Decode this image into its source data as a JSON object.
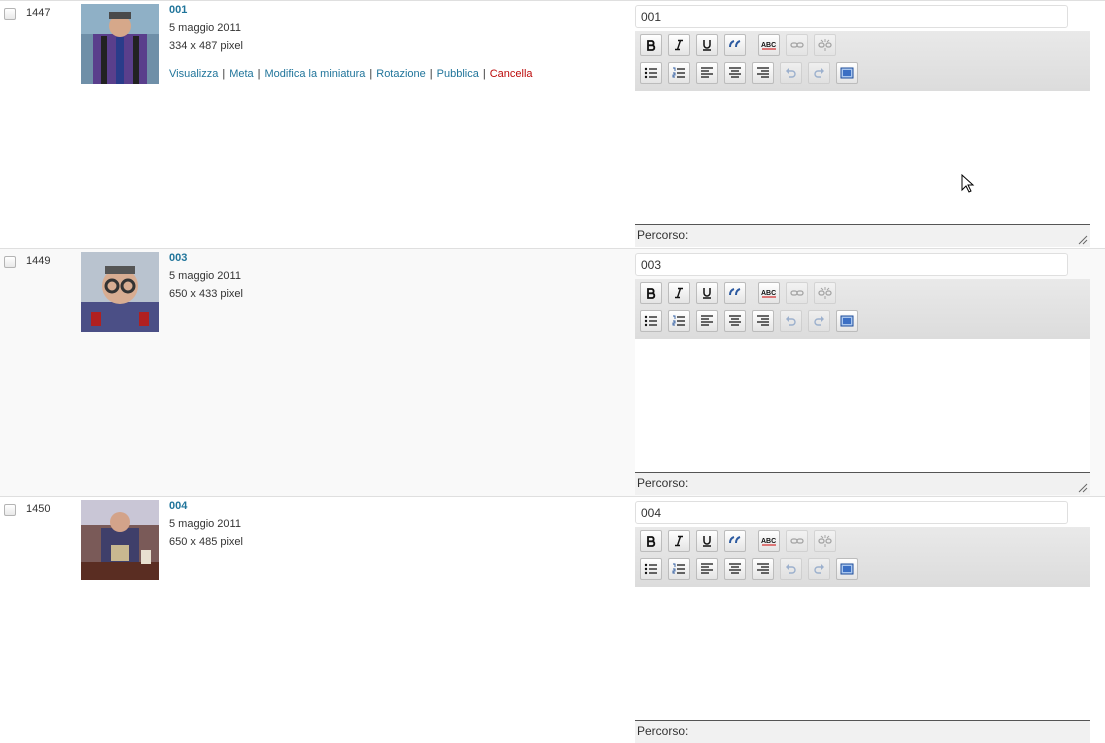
{
  "rows": [
    {
      "id": "1447",
      "title": "001",
      "date": "5 maggio 2011",
      "dimensions": "334 x 487 pixel",
      "caption_value": "001",
      "path_label": "Percorso:",
      "thumb_icon": "person-photo",
      "actions": {
        "view": "Visualizza",
        "meta": "Meta",
        "edit_thumb": "Modifica la miniatura",
        "rotate": "Rotazione",
        "publish": "Pubblica",
        "delete": "Cancella"
      }
    },
    {
      "id": "1449",
      "title": "003",
      "date": "5 maggio 2011",
      "dimensions": "650 x 433 pixel",
      "caption_value": "003",
      "path_label": "Percorso:",
      "thumb_icon": "person-photo"
    },
    {
      "id": "1450",
      "title": "004",
      "date": "5 maggio 2011",
      "dimensions": "650 x 485 pixel",
      "caption_value": "004",
      "path_label": "Percorso:",
      "thumb_icon": "person-photo"
    }
  ],
  "toolbar_icons": {
    "row1": [
      "bold-icon",
      "italic-icon",
      "underline-icon",
      "blockquote-icon",
      "spellcheck-icon",
      "link-icon",
      "unlink-icon"
    ],
    "row2": [
      "bulleted-list-icon",
      "numbered-list-icon",
      "align-left-icon",
      "align-center-icon",
      "align-right-icon",
      "undo-icon",
      "redo-icon",
      "fullscreen-icon"
    ]
  },
  "colors": {
    "link": "#21759b",
    "delete": "#bc0b0b",
    "row_alt_bg": "#f9f9f9",
    "toolbar_bg": "#e0e0e0"
  }
}
